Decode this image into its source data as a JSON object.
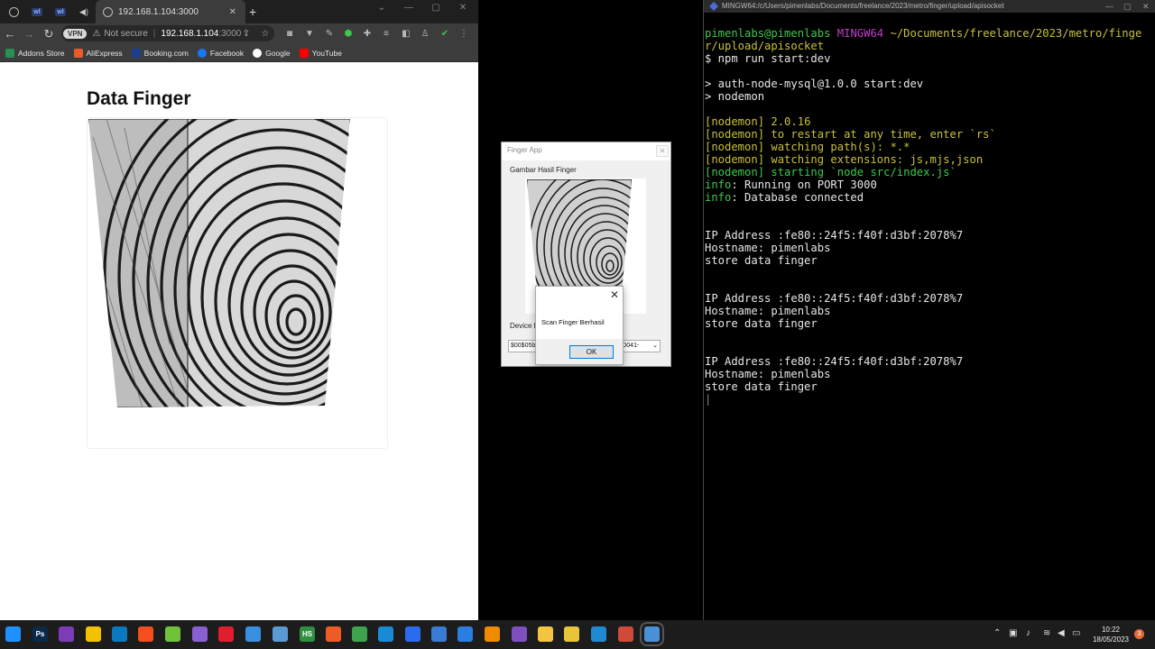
{
  "browser": {
    "tabs": [
      {
        "label": "",
        "icon": "globe-icon"
      },
      {
        "label": "wl",
        "icon": "wl-icon"
      },
      {
        "label": "wl",
        "icon": "wl-icon"
      },
      {
        "label": "",
        "icon": "speaker-icon"
      },
      {
        "label": "192.168.1.104:3000",
        "icon": "globe-icon"
      }
    ],
    "vpn_label": "VPN",
    "security_label": "Not secure",
    "url_host": "192.168.1.104",
    "url_port": ":3000",
    "bookmarks": [
      {
        "label": "Addons Store",
        "color": "#2a8f52"
      },
      {
        "label": "AliExpress",
        "color": "#e85a2a"
      },
      {
        "label": "Booking.com",
        "color": "#1a3d8f"
      },
      {
        "label": "Facebook",
        "color": "#1877f2"
      },
      {
        "label": "Google",
        "color": "#ffffff"
      },
      {
        "label": "YouTube",
        "color": "#ff0000"
      }
    ]
  },
  "page": {
    "title": "Data Finger"
  },
  "finger_app": {
    "window_title": "Finger App",
    "image_label": "Gambar Hasil Finger",
    "device_label": "Device f",
    "select_left": "$00$05b",
    "select_right": "0-D041-"
  },
  "message_box": {
    "text": "Scan Finger Berhasil",
    "ok_label": "OK"
  },
  "terminal": {
    "title": "MINGW64:/c/Users/pimenlabs/Documents/freelance/2023/metro/finger/upload/apisocket",
    "prompt_user": "pimenlabs@pimenlabs",
    "prompt_env": "MINGW64",
    "prompt_path_1": "~/Documents/freelance/2023/metro/finge",
    "prompt_path_2": "r/upload/apisocket",
    "command": "$ npm run start:dev",
    "lines": {
      "l1": "> auth-node-mysql@1.0.0 start:dev",
      "l2": "> nodemon",
      "n1a": "[nodemon]",
      "n1b": " 2.0.16",
      "n2a": "[nodemon]",
      "n2b": " to restart at any time, enter `rs`",
      "n3a": "[nodemon]",
      "n3b": " watching path(s): *.*",
      "n4a": "[nodemon]",
      "n4b": " watching extensions: js,mjs,json",
      "n5a": "[nodemon]",
      "n5b": " starting `node src/index.js`",
      "i1a": "info",
      "i1b": ": Running on PORT 3000",
      "i2a": "info",
      "i2b": ": Database connected",
      "ip": "IP Address :fe80::24f5:f40f:d3bf:2078%7",
      "host": "Hostname: pimenlabs",
      "store": "store data finger"
    }
  },
  "taskbar": {
    "time": "10:22",
    "date": "18/05/2023",
    "notification_count": "3",
    "apps": [
      {
        "name": "windows-start-icon",
        "label": "",
        "color": "#1e90ff"
      },
      {
        "name": "photoshop-icon",
        "label": "Ps",
        "color": "#0b2a4a"
      },
      {
        "name": "tor-browser-icon",
        "label": "",
        "color": "#7d3cb5"
      },
      {
        "name": "mail-app-icon",
        "label": "",
        "color": "#f2c200"
      },
      {
        "name": "trello-icon",
        "label": "",
        "color": "#0a79bf"
      },
      {
        "name": "figma-icon",
        "label": "",
        "color": "#f24e1e"
      },
      {
        "name": "cube-3d-icon",
        "label": "",
        "color": "#6fc23a"
      },
      {
        "name": "tool-icon",
        "label": "",
        "color": "#8a5fd1"
      },
      {
        "name": "opera-icon",
        "label": "",
        "color": "#e01e2e"
      },
      {
        "name": "game-controller-icon",
        "label": "",
        "color": "#3a8ee0"
      },
      {
        "name": "eye-app-icon",
        "label": "",
        "color": "#5a9bd5"
      },
      {
        "name": "hs-icon",
        "label": "HS",
        "color": "#2f8f3f"
      },
      {
        "name": "postman-icon",
        "label": "",
        "color": "#ef5b25"
      },
      {
        "name": "notepad-icon",
        "label": "",
        "color": "#3fa34d"
      },
      {
        "name": "edge-icon",
        "label": "",
        "color": "#1a8ad6"
      },
      {
        "name": "signal-icon",
        "label": "",
        "color": "#2c6bed"
      },
      {
        "name": "share-icon",
        "label": "",
        "color": "#3a7bd5"
      },
      {
        "name": "azure-studio-icon",
        "label": "",
        "color": "#2a7de1"
      },
      {
        "name": "vlc-icon",
        "label": "",
        "color": "#f08a00"
      },
      {
        "name": "visual-studio-icon",
        "label": "",
        "color": "#7e4fc0"
      },
      {
        "name": "file-explorer-icon",
        "label": "",
        "color": "#f4c542"
      },
      {
        "name": "chrome-icon",
        "label": "",
        "color": "#e8c43a"
      },
      {
        "name": "vscode-icon",
        "label": "",
        "color": "#1f8ad2"
      },
      {
        "name": "git-icon",
        "label": "",
        "color": "#d04a3a"
      },
      {
        "name": "finger-app-icon",
        "label": "",
        "color": "#4a90d9"
      }
    ]
  }
}
